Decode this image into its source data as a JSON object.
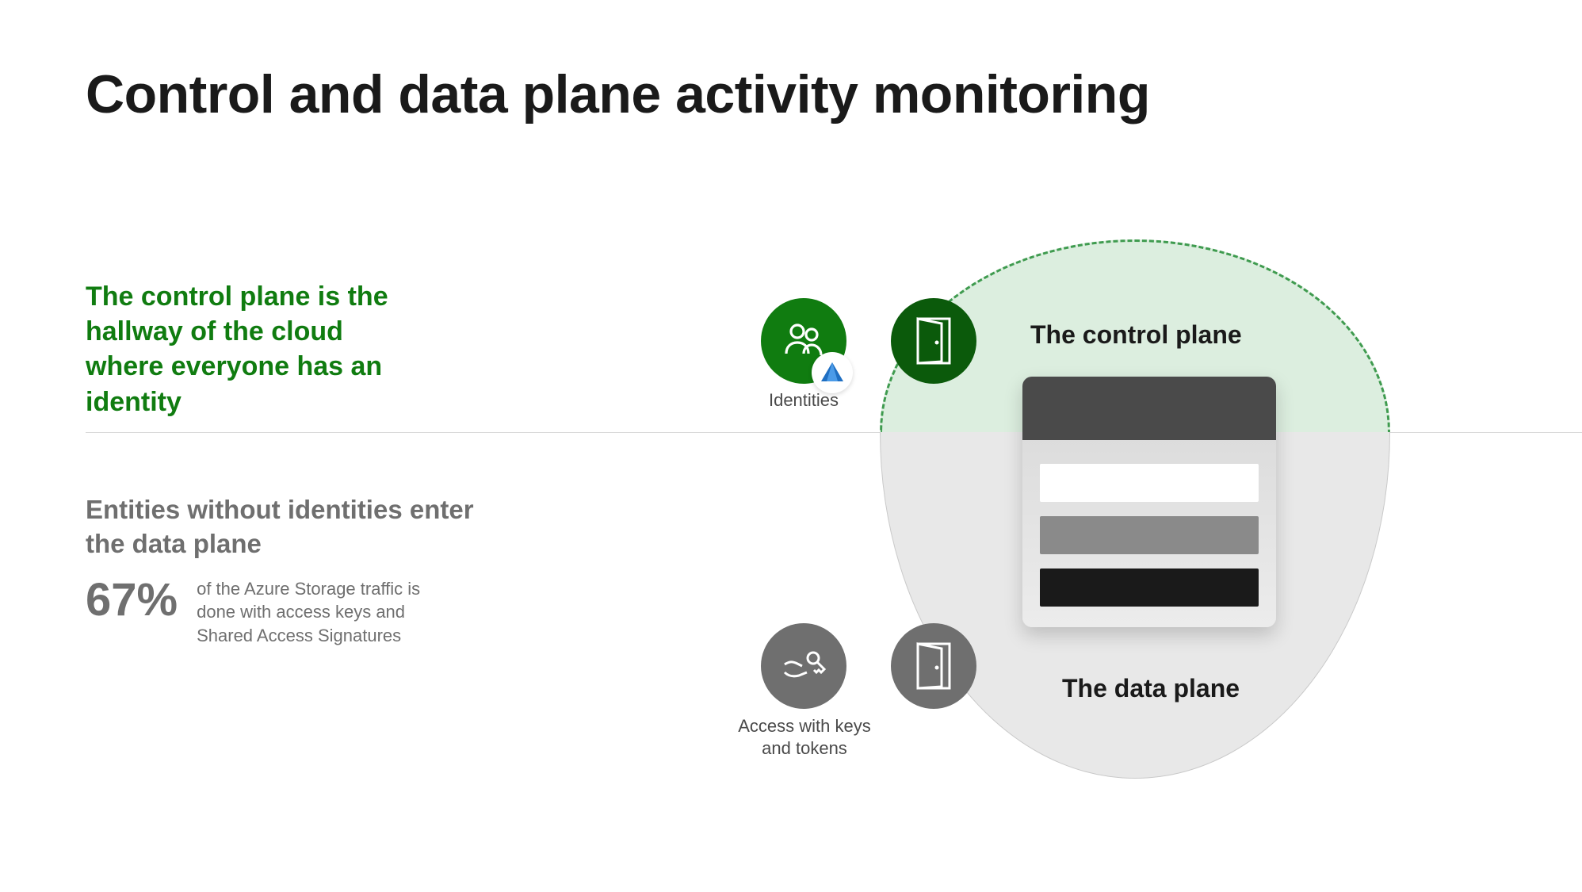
{
  "title": "Control and data plane activity monitoring",
  "control_plane": {
    "blurb": "The control plane is the hallway of the cloud where everyone has an identity",
    "label": "The control plane",
    "identities_label": "Identities"
  },
  "data_plane": {
    "blurb": "Entities without identities enter the data plane",
    "stat_pct": "67%",
    "stat_desc": "of the Azure Storage traffic is done with access keys and Shared Access Signatures",
    "label": "The data plane",
    "keys_label": "Access with keys and tokens"
  },
  "icons": {
    "identities": "people-icon",
    "identities_badge": "azure-ad-icon",
    "door_top": "door-icon",
    "keys": "key-hand-icon",
    "door_bottom": "door-icon"
  }
}
